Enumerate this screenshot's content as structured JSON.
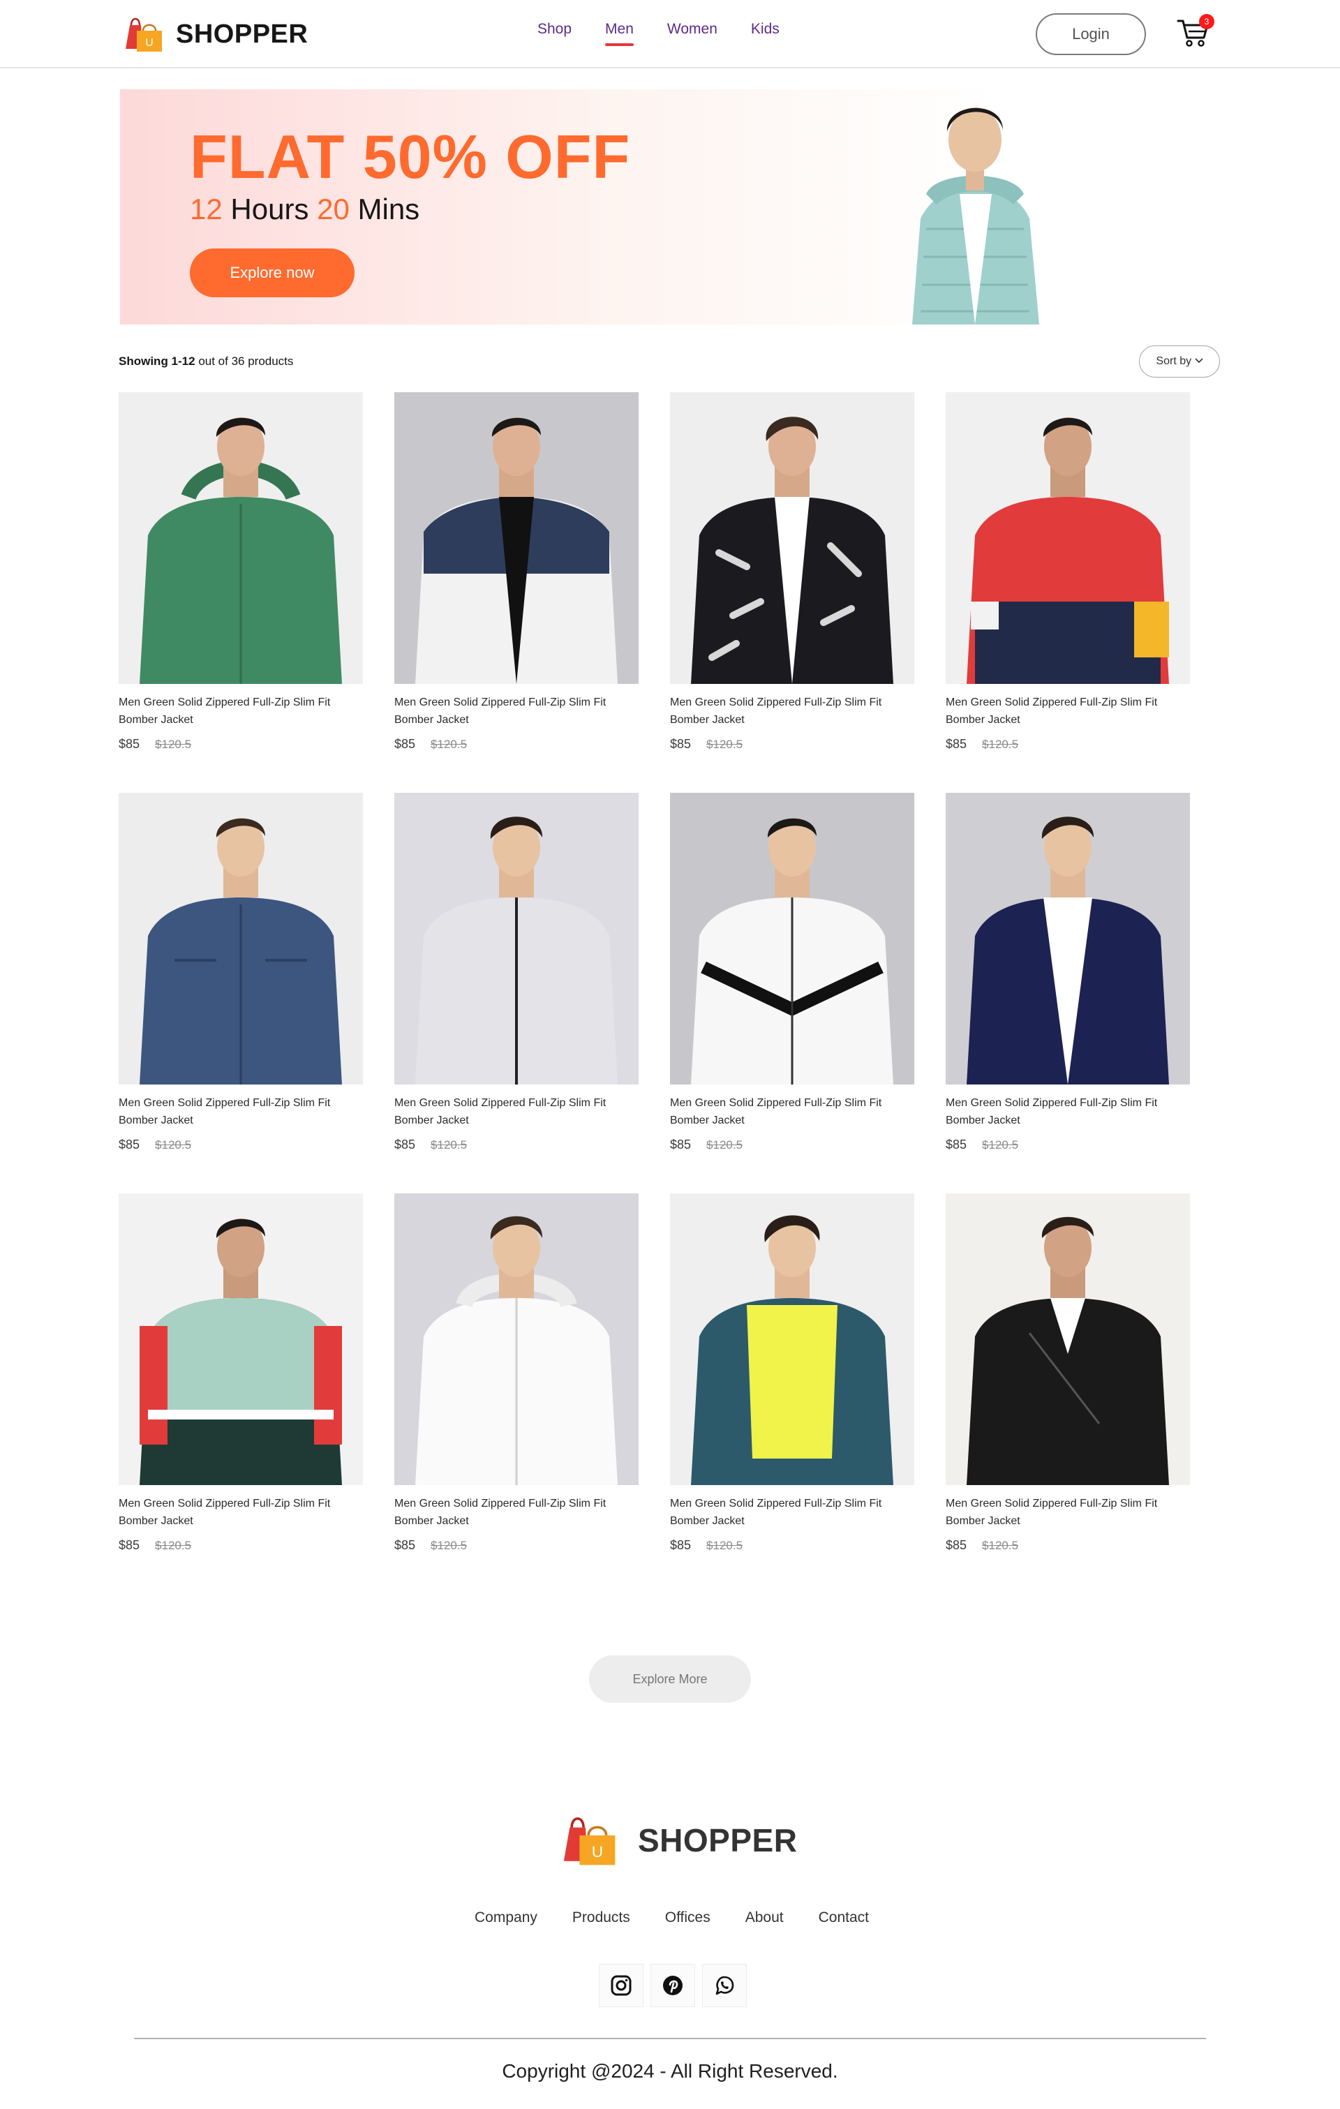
{
  "colors": {
    "accent": "#ff6a2f",
    "nav_text": "#5d2a8a",
    "active_underline": "#e0393c",
    "badge": "#ff1a1a"
  },
  "brand": {
    "name": "SHOPPER",
    "logo_letter": "U"
  },
  "nav": {
    "items": [
      {
        "label": "Shop",
        "active": false
      },
      {
        "label": "Men",
        "active": true
      },
      {
        "label": "Women",
        "active": false
      },
      {
        "label": "Kids",
        "active": false
      }
    ],
    "login_label": "Login",
    "cart_icon": "cart-icon",
    "cart_count": "3"
  },
  "hero": {
    "title": "FLAT 50% OFF",
    "hours_value": "12",
    "hours_label": "Hours",
    "mins_value": "20",
    "mins_label": "Mins",
    "button_label": "Explore now"
  },
  "listing": {
    "showing_bold": "Showing 1-12",
    "showing_rest": "out of 36 products",
    "sort_label": "Sort by",
    "sort_icon": "chevron-down-icon"
  },
  "products": [
    {
      "name": "Men Green Solid Zippered Full-Zip Slim Fit Bomber Jacket",
      "price": "$85",
      "old_price": "$120.5"
    },
    {
      "name": "Men Green Solid Zippered Full-Zip Slim Fit Bomber Jacket",
      "price": "$85",
      "old_price": "$120.5"
    },
    {
      "name": "Men Green Solid Zippered Full-Zip Slim Fit Bomber Jacket",
      "price": "$85",
      "old_price": "$120.5"
    },
    {
      "name": "Men Green Solid Zippered Full-Zip Slim Fit Bomber Jacket",
      "price": "$85",
      "old_price": "$120.5"
    },
    {
      "name": "Men Green Solid Zippered Full-Zip Slim Fit Bomber Jacket",
      "price": "$85",
      "old_price": "$120.5"
    },
    {
      "name": "Men Green Solid Zippered Full-Zip Slim Fit Bomber Jacket",
      "price": "$85",
      "old_price": "$120.5"
    },
    {
      "name": "Men Green Solid Zippered Full-Zip Slim Fit Bomber Jacket",
      "price": "$85",
      "old_price": "$120.5"
    },
    {
      "name": "Men Green Solid Zippered Full-Zip Slim Fit Bomber Jacket",
      "price": "$85",
      "old_price": "$120.5"
    },
    {
      "name": "Men Green Solid Zippered Full-Zip Slim Fit Bomber Jacket",
      "price": "$85",
      "old_price": "$120.5"
    },
    {
      "name": "Men Green Solid Zippered Full-Zip Slim Fit Bomber Jacket",
      "price": "$85",
      "old_price": "$120.5"
    },
    {
      "name": "Men Green Solid Zippered Full-Zip Slim Fit Bomber Jacket",
      "price": "$85",
      "old_price": "$120.5"
    },
    {
      "name": "Men Green Solid Zippered Full-Zip Slim Fit Bomber Jacket",
      "price": "$85",
      "old_price": "$120.5"
    }
  ],
  "explore_more_label": "Explore More",
  "footer": {
    "brand_name": "SHOPPER",
    "links": [
      "Company",
      "Products",
      "Offices",
      "About",
      "Contact"
    ],
    "socials": [
      "instagram-icon",
      "pinterest-icon",
      "whatsapp-icon"
    ],
    "copyright": "Copyright @2024 - All Right Reserved."
  }
}
